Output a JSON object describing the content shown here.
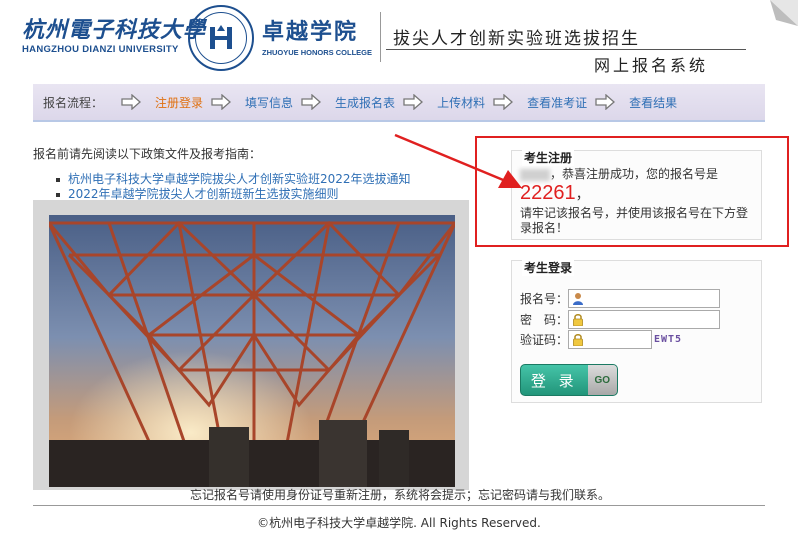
{
  "header": {
    "university_cn": "杭州電子科技大學",
    "university_en": "HANGZHOU DIANZI UNIVERSITY",
    "college_cn": "卓越学院",
    "college_en": "ZHUOYUE HONORS COLLEGE",
    "banner_title": "拔尖人才创新实验班选拔招生",
    "banner_subtitle": "网上报名系统"
  },
  "steps": {
    "label": "报名流程：",
    "items": [
      {
        "label": "注册登录",
        "active": true
      },
      {
        "label": "填写信息",
        "active": false
      },
      {
        "label": "生成报名表",
        "active": false
      },
      {
        "label": "上传材料",
        "active": false
      },
      {
        "label": "查看准考证",
        "active": false
      },
      {
        "label": "查看结果",
        "active": false
      }
    ]
  },
  "intro": {
    "text": "报名前请先阅读以下政策文件及报考指南：",
    "links": [
      "杭州电子科技大学卓越学院拔尖人才创新实验班2022年选拔通知",
      "2022年卓越学院拔尖人才创新班新生选拔实施细则"
    ]
  },
  "registration": {
    "title": "考生注册",
    "success_msg": "，恭喜注册成功，您的报名号是",
    "number": "22261",
    "comma": "，",
    "remember_msg": "请牢记该报名号，并使用该报名号在下方登录报名！"
  },
  "login": {
    "title": "考生登录",
    "username_label": "报名号：",
    "password_label": "密　码：",
    "captcha_label": "验证码：",
    "username_value": "",
    "password_value": "",
    "captcha_value": "",
    "captcha_image_text": "EWT5",
    "button_label": "登 录",
    "button_go": "GO"
  },
  "footer": {
    "forgot_note": "忘记报名号请使用身份证号重新注册，系统将会提示；忘记密码请与我们联系。",
    "copyright": "©杭州电子科技大学卓越学院. All Rights Reserved."
  },
  "colors": {
    "brand_blue": "#1d4f8f",
    "link_blue": "#2f6fb5",
    "active_step": "#e07010",
    "highlight_red": "#e02020",
    "login_green": "#22957a"
  }
}
